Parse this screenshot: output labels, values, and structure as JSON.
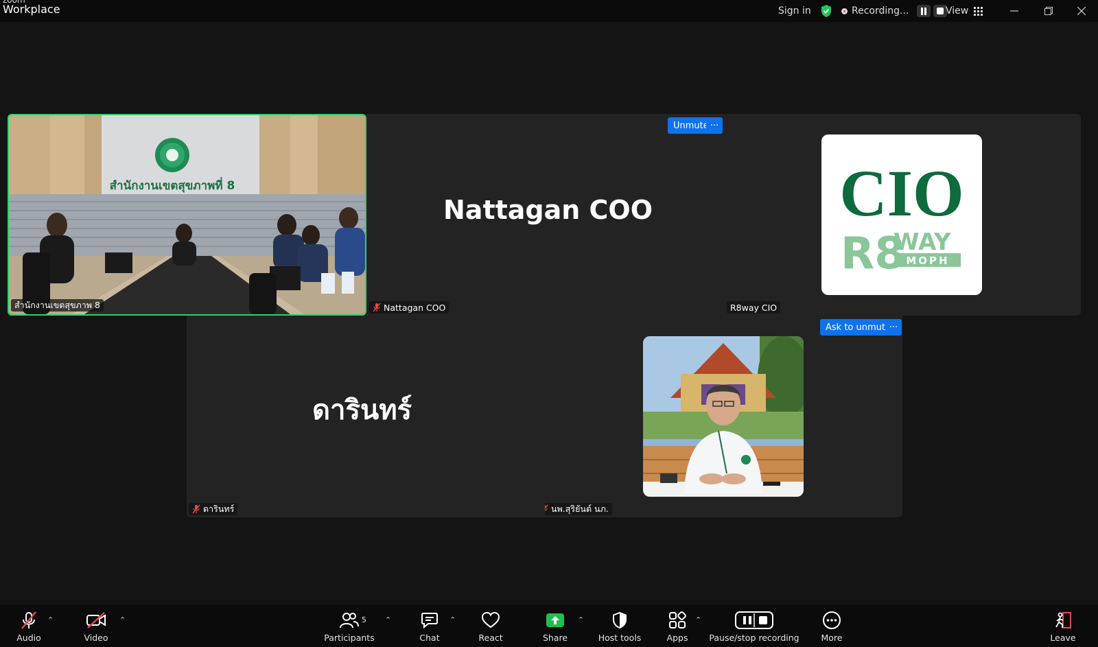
{
  "titlebar": {
    "app_name_small": "zoom",
    "app_name": "Workplace",
    "sign_in": "Sign in",
    "recording": "Recording...",
    "view": "View"
  },
  "colors": {
    "active_speaker_border": "#2fd16b",
    "action_blue": "#0e72ed",
    "share_green": "#1fbf4f",
    "muted_red": "#e5484d",
    "cio_green": "#0d6b3c",
    "r8_green": "#8ac69a"
  },
  "tiles": [
    {
      "name": "สำนักงานเขตสุขภาพ 8",
      "muted": false,
      "sign_text": "สำนักงานเขตสุขภาพที่ 8"
    },
    {
      "name": "Nattagan COO",
      "muted": true,
      "display_name": "Nattagan COO"
    },
    {
      "name": "R8way CIO",
      "muted": false,
      "actions": {
        "unmute": "Unmute",
        "more": "···"
      },
      "logo": {
        "line1": "CIO",
        "line2": "R8",
        "line3": "WAY",
        "line4": "MOPH"
      }
    },
    {
      "name": "ดารินทร์",
      "muted": true,
      "display_name": "ดารินทร์"
    },
    {
      "name": "นพ.สุริยันต์ นภ.",
      "muted": true,
      "actions": {
        "ask_to_unmute": "Ask to unmute",
        "more": "···"
      }
    }
  ],
  "toolbar": {
    "audio": "Audio",
    "video": "Video",
    "participants": "Participants",
    "participants_count": "5",
    "chat": "Chat",
    "react": "React",
    "share": "Share",
    "host_tools": "Host tools",
    "apps": "Apps",
    "pause_stop": "Pause/stop recording",
    "more": "More",
    "leave": "Leave"
  }
}
